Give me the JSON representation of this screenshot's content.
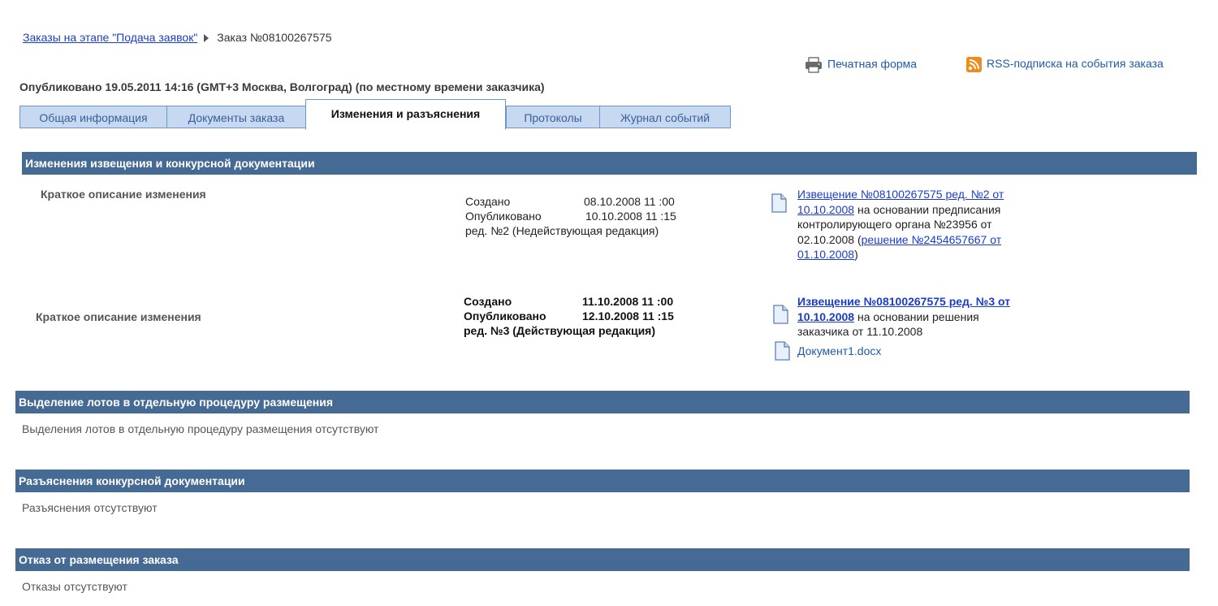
{
  "breadcrumb": {
    "link": "Заказы на этапе \"Подача заявок\"",
    "current": "Заказ №08100267575"
  },
  "actions": {
    "print": "Печатная форма",
    "rss": "RSS-подписка на события заказа"
  },
  "published": "Опубликовано 19.05.2011 14:16 (GMT+3 Москва, Волгоград) (по местному времени заказчика)",
  "tabs": [
    {
      "label": "Общая информация"
    },
    {
      "label": "Документы заказа"
    },
    {
      "label": "Изменения и разъяснения",
      "active": true
    },
    {
      "label": "Протоколы"
    },
    {
      "label": "Журнал событий"
    }
  ],
  "sections": {
    "changes": {
      "title": "Изменения извещения и конкурсной документации",
      "items": [
        {
          "description": "Краткое описание изменения",
          "created_label": "Создано",
          "created_value": "08.10.2008 11 :00",
          "published_label": "Опубликовано",
          "published_value": "10.10.2008 11 :15",
          "edition": "ред. №2 (Недействующая редакция)",
          "notice_link_1": "Извещение №08100267575 ред. №2  от",
          "notice_link_2": "10.10.2008",
          "notice_text_1": " на основании предписания",
          "notice_text_2": "контролирующего органа №23956  от",
          "notice_text_3": "02.10.2008 (",
          "decision_link_1": "решение №2454657667 от",
          "decision_link_2": "01.10.2008",
          "notice_text_4": ")"
        },
        {
          "description": "Краткое описание изменения",
          "created_label": "Создано",
          "created_value": "11.10.2008 11 :00",
          "published_label": "Опубликовано",
          "published_value": "12.10.2008 11 :15",
          "edition": "ред. №3 (Действующая редакция)",
          "notice_link_1": "Извещение №08100267575 ред. №3  от",
          "notice_link_2": "10.10.2008",
          "notice_text_1": " на основании решения",
          "notice_text_2": "заказчика  от 11.10.2008",
          "attachment": "Документ1.docx"
        }
      ]
    },
    "lots": {
      "title": "Выделение лотов в отдельную процедуру размещения",
      "empty": "Выделения лотов в отдельную процедуру размещения отсутствуют"
    },
    "clarifications": {
      "title": "Разъяснения конкурсной документации",
      "empty": "Разъяснения отсутствуют"
    },
    "refusal": {
      "title": "Отказ от размещения заказа",
      "empty": "Отказы отсутствуют"
    }
  }
}
